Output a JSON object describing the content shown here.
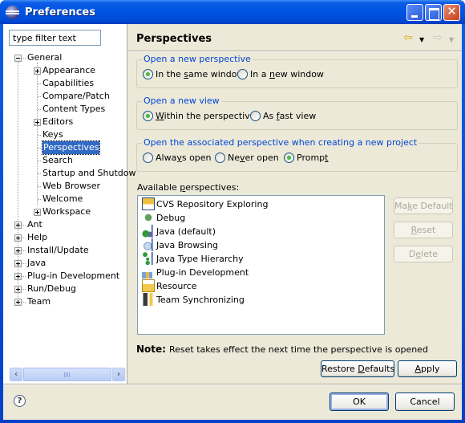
{
  "window": {
    "title": "Preferences"
  },
  "filter": {
    "placeholder": "type filter text",
    "value": "type filter text"
  },
  "tree": [
    {
      "label": "General",
      "expanded": true,
      "level": 0
    },
    {
      "label": "Appearance",
      "expandable": true,
      "level": 1
    },
    {
      "label": "Capabilities",
      "level": 1
    },
    {
      "label": "Compare/Patch",
      "level": 1
    },
    {
      "label": "Content Types",
      "level": 1
    },
    {
      "label": "Editors",
      "expandable": true,
      "level": 1
    },
    {
      "label": "Keys",
      "level": 1
    },
    {
      "label": "Perspectives",
      "level": 1,
      "selected": true
    },
    {
      "label": "Search",
      "level": 1
    },
    {
      "label": "Startup and Shutdow",
      "level": 1
    },
    {
      "label": "Web Browser",
      "level": 1
    },
    {
      "label": "Welcome",
      "level": 1
    },
    {
      "label": "Workspace",
      "expandable": true,
      "level": 1
    },
    {
      "label": "Ant",
      "expandable": true,
      "level": 0
    },
    {
      "label": "Help",
      "expandable": true,
      "level": 0
    },
    {
      "label": "Install/Update",
      "expandable": true,
      "level": 0
    },
    {
      "label": "Java",
      "expandable": true,
      "level": 0
    },
    {
      "label": "Plug-in Development",
      "expandable": true,
      "level": 0
    },
    {
      "label": "Run/Debug",
      "expandable": true,
      "level": 0
    },
    {
      "label": "Team",
      "expandable": true,
      "level": 0
    }
  ],
  "page": {
    "title": "Perspectives",
    "nav": {
      "back_icon": "back-arrow-icon",
      "forward_icon": "forward-arrow-icon"
    },
    "groups": [
      {
        "label": "Open a new perspective",
        "options": [
          {
            "pre": "In the ",
            "mn": "s",
            "post": "ame window",
            "checked": true
          },
          {
            "pre": "In a ",
            "mn": "n",
            "post": "ew window",
            "checked": false
          }
        ]
      },
      {
        "label": "Open a new view",
        "options": [
          {
            "pre": "",
            "mn": "W",
            "post": "ithin the perspective",
            "checked": true
          },
          {
            "pre": "As ",
            "mn": "f",
            "post": "ast view",
            "checked": false
          }
        ]
      },
      {
        "label": "Open the associated perspective when creating a new project",
        "options": [
          {
            "pre": "Alwa",
            "mn": "y",
            "post": "s open",
            "checked": false
          },
          {
            "pre": "Ne",
            "mn": "v",
            "post": "er open",
            "checked": false
          },
          {
            "pre": "Promp",
            "mn": "t",
            "post": "",
            "checked": true
          }
        ]
      }
    ],
    "available": {
      "label_pre": "Available ",
      "label_mn": "p",
      "label_post": "erspectives:",
      "items": [
        {
          "label": "CVS Repository Exploring",
          "icon": "cvs-icon"
        },
        {
          "label": "Debug",
          "icon": "debug-bug-icon"
        },
        {
          "label": "Java (default)",
          "icon": "java-perspective-icon"
        },
        {
          "label": "Java Browsing",
          "icon": "java-browsing-icon"
        },
        {
          "label": "Java Type Hierarchy",
          "icon": "type-hierarchy-icon"
        },
        {
          "label": "Plug-in Development",
          "icon": "plugin-icon"
        },
        {
          "label": "Resource",
          "icon": "resource-folder-icon"
        },
        {
          "label": "Team Synchronizing",
          "icon": "team-sync-icon"
        }
      ]
    },
    "side_buttons": [
      {
        "pre": "Ma",
        "mn": "k",
        "post": "e Default",
        "enabled": false
      },
      {
        "pre": "",
        "mn": "R",
        "post": "eset",
        "enabled": false
      },
      {
        "pre": "D",
        "mn": "e",
        "post": "lete",
        "enabled": false
      }
    ],
    "note": {
      "label": "Note:",
      "text": "Reset takes effect the next time the perspective is opened"
    },
    "restore_defaults": {
      "pre": "Restore ",
      "mn": "D",
      "post": "efaults"
    },
    "apply": {
      "pre": "",
      "mn": "A",
      "post": "pply"
    }
  },
  "footer": {
    "ok": "OK",
    "cancel": "Cancel",
    "help_icon": "help-icon"
  }
}
